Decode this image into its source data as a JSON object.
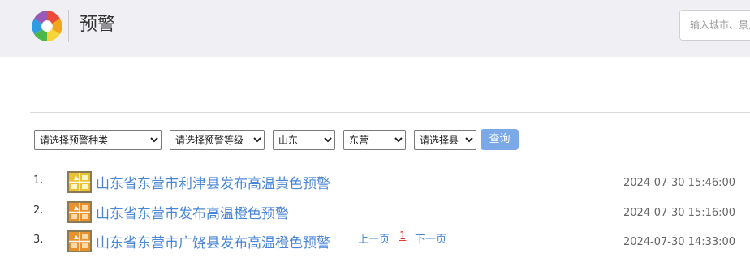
{
  "header": {
    "title": "预警",
    "search_placeholder": "输入城市、景点名称"
  },
  "filters": {
    "type": {
      "selected": "请选择预警种类",
      "options": [
        "请选择预警种类"
      ]
    },
    "level": {
      "selected": "请选择预警等级",
      "options": [
        "请选择预警等级"
      ]
    },
    "province": {
      "selected": "山东",
      "options": [
        "山东"
      ]
    },
    "city": {
      "selected": "东营",
      "options": [
        "东营"
      ]
    },
    "county": {
      "selected": "请选择县",
      "options": [
        "请选择县"
      ]
    },
    "query_label": "查询"
  },
  "warnings": [
    {
      "index": "1.",
      "title": "山东省东营市利津县发布高温黄色预警",
      "time": "2024-07-30 15:46:00",
      "level_color": "#e8c233",
      "icon": "heat-yellow-icon"
    },
    {
      "index": "2.",
      "title": "山东省东营市发布高温橙色预警",
      "time": "2024-07-30 15:16:00",
      "level_color": "#e8922d",
      "icon": "heat-orange-icon"
    },
    {
      "index": "3.",
      "title": "山东省东营市广饶县发布高温橙色预警",
      "time": "2024-07-30 14:33:00",
      "level_color": "#e8922d",
      "icon": "heat-orange-icon"
    }
  ],
  "pagination": {
    "prev_label": "上一页",
    "current_page": "1",
    "next_label": "下一页"
  },
  "colors": {
    "header_bg": "#f0f0f4",
    "link": "#4a86d6",
    "button": "#7ba8e6",
    "current_page": "#e03b2f"
  }
}
